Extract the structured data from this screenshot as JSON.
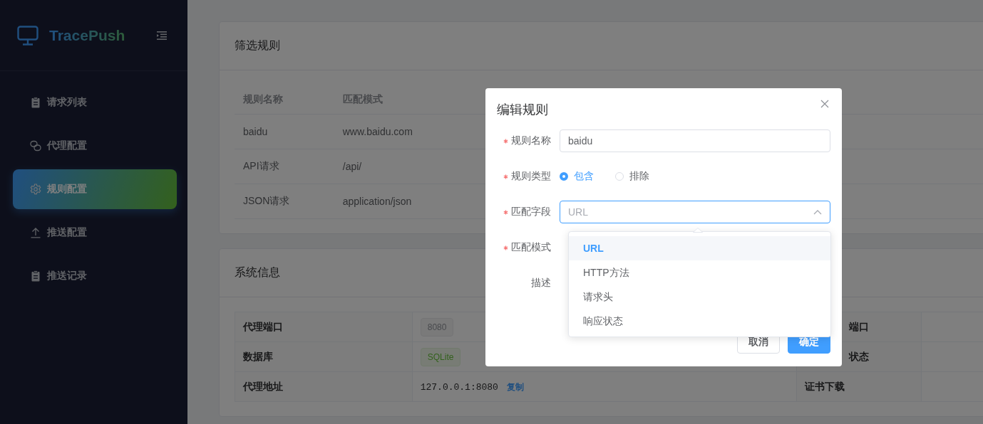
{
  "sidebar": {
    "logo": "TracePush",
    "items": [
      {
        "label": "请求列表",
        "kind": "clipboard",
        "selected": false
      },
      {
        "label": "代理配置",
        "kind": "link",
        "selected": false
      },
      {
        "label": "规则配置",
        "kind": "gear",
        "selected": true
      },
      {
        "label": "推送配置",
        "kind": "upload",
        "selected": false
      },
      {
        "label": "推送记录",
        "kind": "clipboard",
        "selected": false
      }
    ]
  },
  "filter_card": {
    "title": "筛选规则",
    "columns": [
      "规则名称",
      "匹配模式"
    ],
    "rows": [
      [
        "baidu",
        "www.baidu.com"
      ],
      [
        "API请求",
        "/api/"
      ],
      [
        "JSON请求",
        "application/json"
      ]
    ]
  },
  "system_card": {
    "title": "系统信息",
    "rows": [
      {
        "label": "代理端口",
        "kind": "info-tag",
        "value": "8080",
        "label_2": "端口",
        "label_2_clipped": true
      },
      {
        "label": "数据库",
        "kind": "success-tag",
        "value": "SQLite",
        "label_2": "状态",
        "label_2_clipped": true
      },
      {
        "label": "代理地址",
        "kind": "address",
        "value": "127.0.0.1:8080",
        "link": "复制",
        "label_2": "证书下载"
      }
    ]
  },
  "dialog": {
    "title": "编辑规则",
    "fields": [
      {
        "label": "规则名称",
        "required": true,
        "kind": "input",
        "value": "baidu"
      },
      {
        "label": "规则类型",
        "required": true,
        "kind": "radio",
        "options": [
          {
            "label": "包含",
            "selected": true
          },
          {
            "label": "排除",
            "selected": false
          }
        ]
      },
      {
        "label": "匹配字段",
        "required": true,
        "kind": "select",
        "placeholder": "URL",
        "expanded": true
      },
      {
        "label": "匹配模式",
        "required": true,
        "kind": "covered"
      },
      {
        "label": "描述",
        "required": false,
        "kind": "covered"
      }
    ],
    "buttons": [
      {
        "label": "取消",
        "primary": false
      },
      {
        "label": "确定",
        "primary": true
      }
    ],
    "dropdown": {
      "options": [
        {
          "label": "URL",
          "selected": true
        },
        {
          "label": "HTTP方法",
          "selected": false
        },
        {
          "label": "请求头",
          "selected": false
        },
        {
          "label": "响应状态",
          "selected": false
        }
      ]
    }
  }
}
